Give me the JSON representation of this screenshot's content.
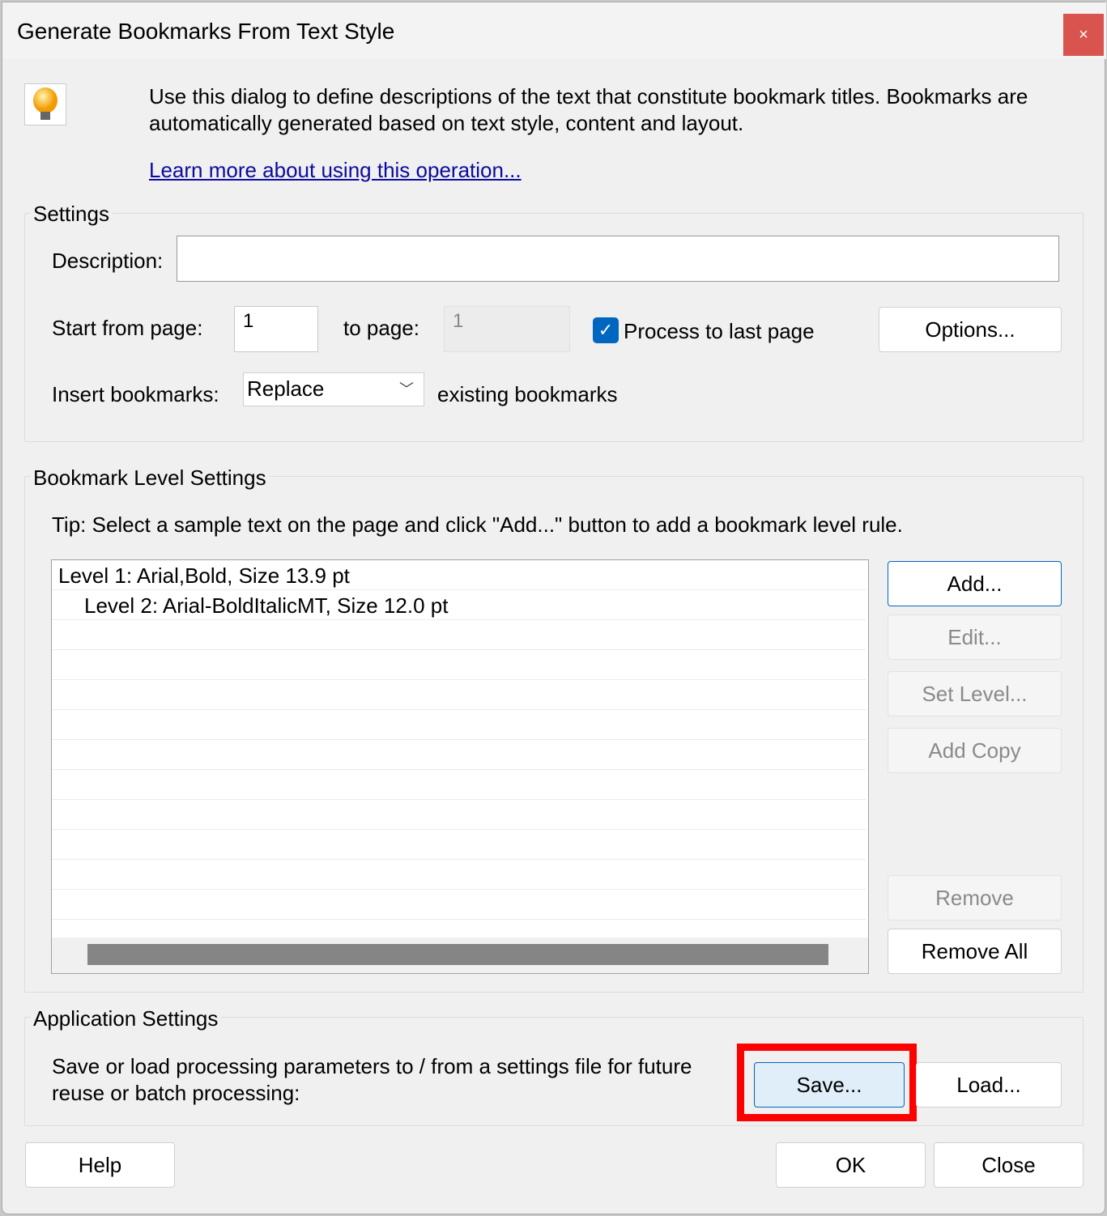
{
  "window": {
    "title": "Generate Bookmarks From Text Style",
    "close_label": "×"
  },
  "intro": {
    "line1": "Use this dialog to define descriptions of the text that constitute bookmark titles. Bookmarks are",
    "line2": "automatically generated based on text style, content and layout.",
    "link": "Learn more about using this operation...",
    "icon": "lightbulb-icon"
  },
  "settings": {
    "legend": "Settings",
    "description_label": "Description:",
    "description_value": "",
    "start_label": "Start from page:",
    "start_value": "1",
    "to_label": "to page:",
    "to_value": "1",
    "process_last_label": "Process to last page",
    "process_last_checked": true,
    "options_button": "Options...",
    "insert_label": "Insert bookmarks:",
    "insert_value": "Replace",
    "insert_suffix": "existing bookmarks"
  },
  "levels": {
    "legend": "Bookmark Level Settings",
    "tip": "Tip: Select a sample text on the page and click \"Add...\" button to add a bookmark level rule.",
    "items": [
      "Level 1: Arial,Bold, Size 13.9 pt",
      "Level 2: Arial-BoldItalicMT, Size 12.0 pt"
    ],
    "buttons": {
      "add": "Add...",
      "edit": "Edit...",
      "set_level": "Set Level...",
      "add_copy": "Add Copy",
      "remove": "Remove",
      "remove_all": "Remove All"
    }
  },
  "app": {
    "legend": "Application Settings",
    "text1": "Save or load processing parameters to / from a settings file for future",
    "text2": "reuse or batch processing:",
    "save": "Save...",
    "load": "Load..."
  },
  "footer": {
    "help": "Help",
    "ok": "OK",
    "close": "Close"
  },
  "colors": {
    "accent": "#0067c0",
    "highlight": "#ff0000",
    "link": "#0b0b9e"
  }
}
